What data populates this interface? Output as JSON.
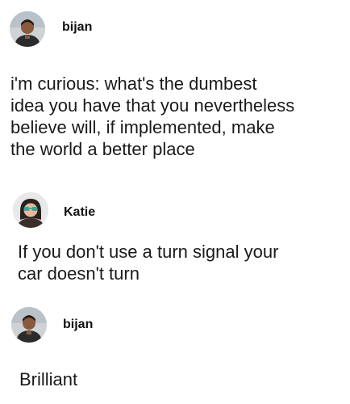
{
  "posts": [
    {
      "username": "bijan",
      "avatar": "person-avatar",
      "lines": [
        "i'm curious: what's the dumbest",
        "idea you have that you nevertheless",
        "believe will, if implemented, make",
        "the world a better place"
      ]
    },
    {
      "username": "Katie",
      "avatar": "person-avatar",
      "lines": [
        "If you don't use a turn signal your",
        "car doesn't turn"
      ]
    },
    {
      "username": "bijan",
      "avatar": "person-avatar",
      "lines": [
        "Brilliant"
      ]
    }
  ]
}
